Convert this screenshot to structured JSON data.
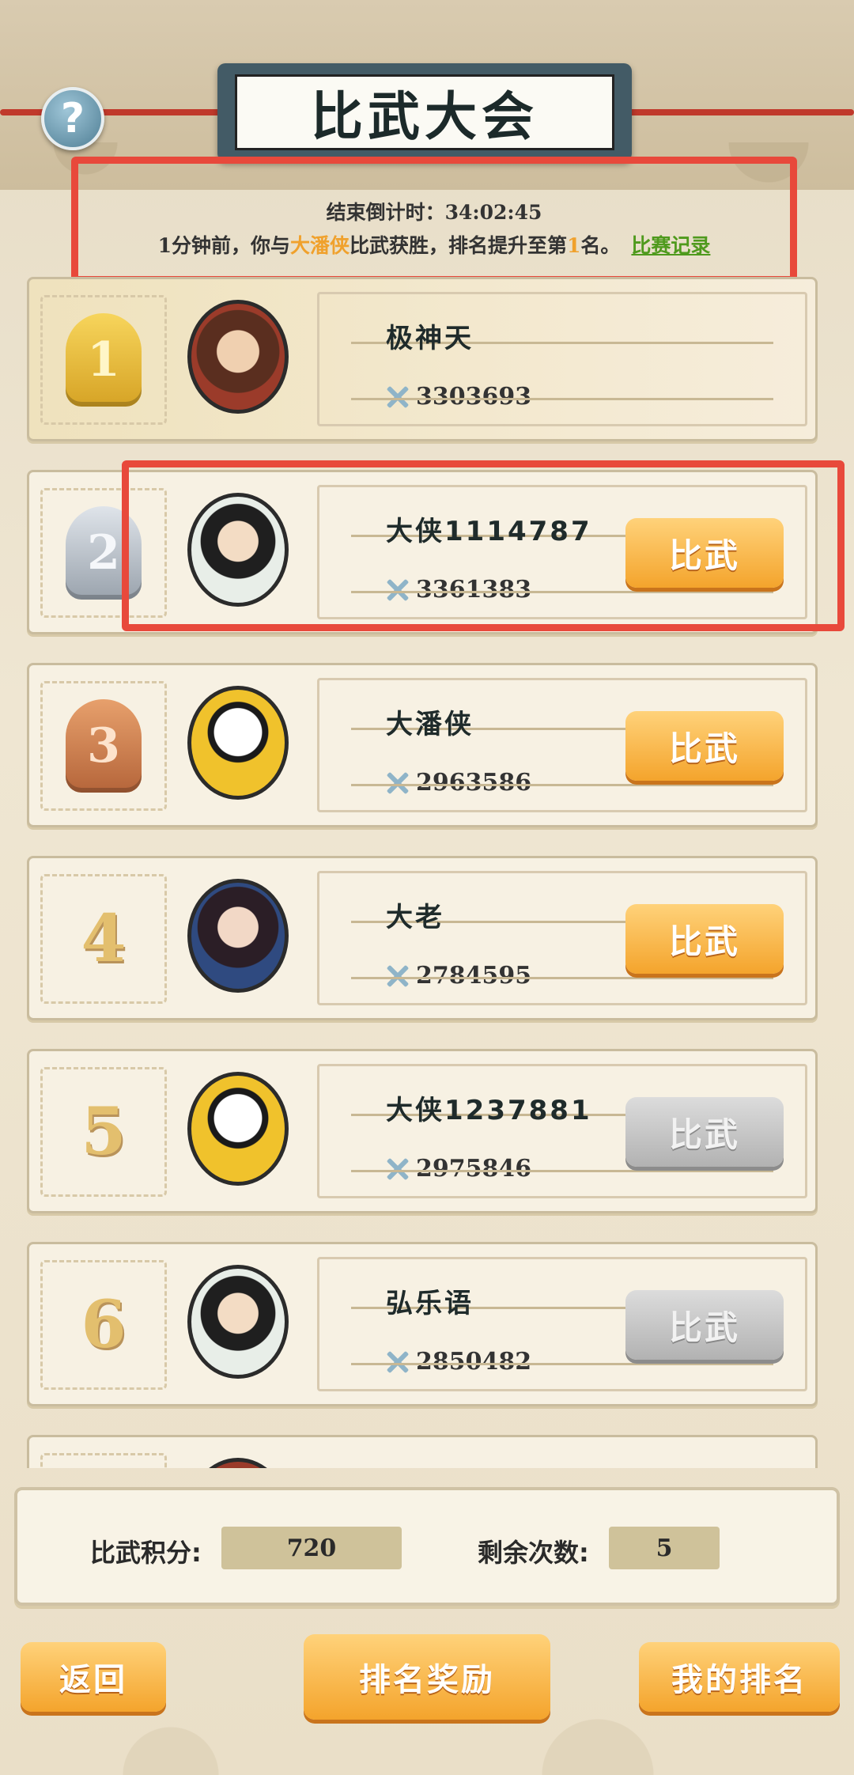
{
  "header": {
    "title": "比武大会",
    "help_icon": "?"
  },
  "notice": {
    "countdown_label": "结束倒计时：",
    "countdown_value": "34:02:45",
    "msg_prefix": "1分钟前，你与",
    "opponent": "大潘侠",
    "msg_middle": "比武获胜，排名提升至第",
    "rank": "1",
    "msg_suffix": "名。",
    "record_link": "比赛记录"
  },
  "players": [
    {
      "rank": "1",
      "name": "极神天",
      "power": "3303693",
      "button": ""
    },
    {
      "rank": "2",
      "name": "大侠1114787",
      "power": "3361383",
      "button": "比武"
    },
    {
      "rank": "3",
      "name": "大潘侠",
      "power": "2963586",
      "button": "比武"
    },
    {
      "rank": "4",
      "name": "大老",
      "power": "2784595",
      "button": "比武"
    },
    {
      "rank": "5",
      "name": "大侠1237881",
      "power": "2975846",
      "button": "比武"
    },
    {
      "rank": "6",
      "name": "弘乐语",
      "power": "2850482",
      "button": "比武"
    }
  ],
  "stats": {
    "score_label": "比武积分:",
    "score_value": "720",
    "remaining_label": "剩余次数:",
    "remaining_value": "5"
  },
  "footer": {
    "back": "返回",
    "rewards": "排名奖励",
    "my_rank": "我的排名"
  },
  "colors": {
    "highlight_border": "#e8493b",
    "button_orange": "#f4a42c",
    "button_disabled": "#b2b2b2",
    "link_green": "#4f9a1d",
    "name_highlight": "#f0a12c"
  }
}
